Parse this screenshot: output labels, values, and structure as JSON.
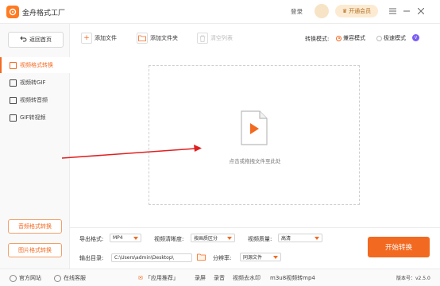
{
  "app": {
    "title": "金舟格式工厂",
    "logo_icon": "app-logo-icon",
    "accent": "#f26a21"
  },
  "titlebar": {
    "login": "登录",
    "vip_button": "开通会员"
  },
  "sidebar": {
    "back_label": "返回首页",
    "items": [
      {
        "label": "视频格式转换",
        "icon": "video-convert-icon",
        "active": true
      },
      {
        "label": "视频转GIF",
        "icon": "gif-icon",
        "active": false
      },
      {
        "label": "视频转音频",
        "icon": "audio-icon",
        "active": false
      },
      {
        "label": "GIF转视频",
        "icon": "gif-video-icon",
        "active": false
      }
    ],
    "audio_convert": "音频格式转换",
    "image_convert": "图片格式转换"
  },
  "toolbar": {
    "add_file": "添加文件",
    "add_folder": "添加文件夹",
    "clear_list": "清空列表",
    "mode_label": "转换模式:",
    "mode_compatible": "兼容模式",
    "mode_fast": "极速模式",
    "vip_badge": "V"
  },
  "dropzone": {
    "hint": "点击或拖拽文件至此处"
  },
  "settings": {
    "export_format_label": "导出格式:",
    "export_format_value": "MP4",
    "clarity_label": "视频清晰度:",
    "clarity_value": "按画质区分",
    "quality_label": "视频质量:",
    "quality_value": "高清",
    "output_label": "输出目录:",
    "output_value": "C:\\Users\\admin\\Desktop\\",
    "output_more": "•••",
    "split_label": "分辨率:",
    "split_value": "同源文件",
    "start_button": "开始转换"
  },
  "statusbar": {
    "website": "官方网站",
    "support": "在线客服",
    "promo": "「应用推荐」",
    "links": [
      "录屏",
      "录音",
      "视频去水印",
      "m3u8视频转mp4"
    ],
    "version": "版本号：v2.5.0"
  }
}
